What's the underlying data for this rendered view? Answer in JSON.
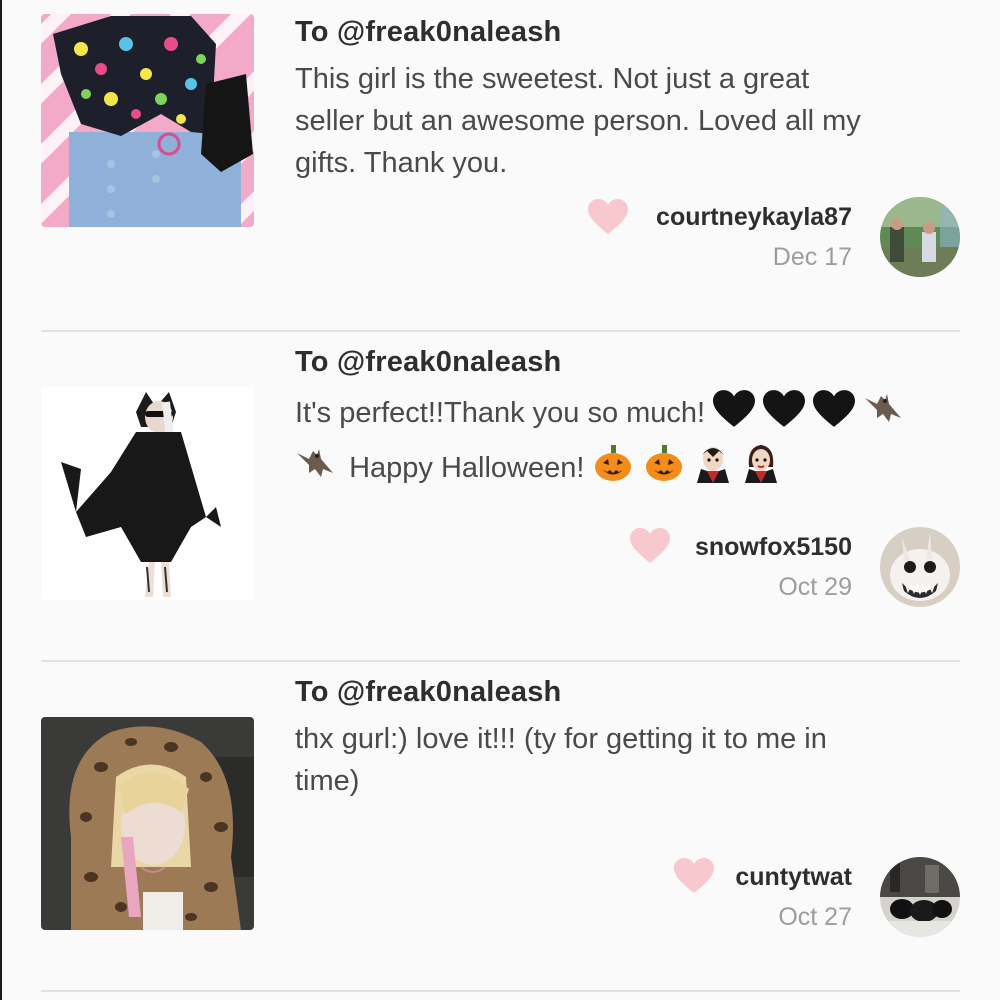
{
  "reviews": [
    {
      "to": "To @freak0naleash",
      "text_lines": [
        "This girl is the sweetest. Not just a great",
        "seller but an awesome person. Loved all my",
        "gifts. Thank you."
      ],
      "username": "courtneykayla87",
      "date": "Dec 17",
      "thumb": "outfit-photo",
      "avatar": "outdoor-people-avatar"
    },
    {
      "to": "To @freak0naleash",
      "text_line1": "It's perfect!!Thank you so much!",
      "text_line2": "Happy Halloween!",
      "emoji_line1": [
        "black-heart",
        "black-heart",
        "black-heart",
        "bat"
      ],
      "emoji_line2_prefix": [
        "bat"
      ],
      "emoji_line2": [
        "jack-o-lantern",
        "jack-o-lantern",
        "vampire-man",
        "vampire-woman"
      ],
      "username": "snowfox5150",
      "date": "Oct 29",
      "thumb": "bat-costume-photo",
      "avatar": "white-creature-avatar"
    },
    {
      "to": "To @freak0naleash",
      "text_lines": [
        "thx gurl:) love it!!! (ty for getting it to me in",
        "time)"
      ],
      "username": "cuntytwat",
      "date": "Oct 27",
      "thumb": "leopard-hood-selfie",
      "avatar": "dark-group-avatar"
    }
  ],
  "colors": {
    "heart": "#f7c9cf",
    "divider": "#e2e1e2",
    "date": "#9d9d9d",
    "background": "#fbfafb"
  }
}
